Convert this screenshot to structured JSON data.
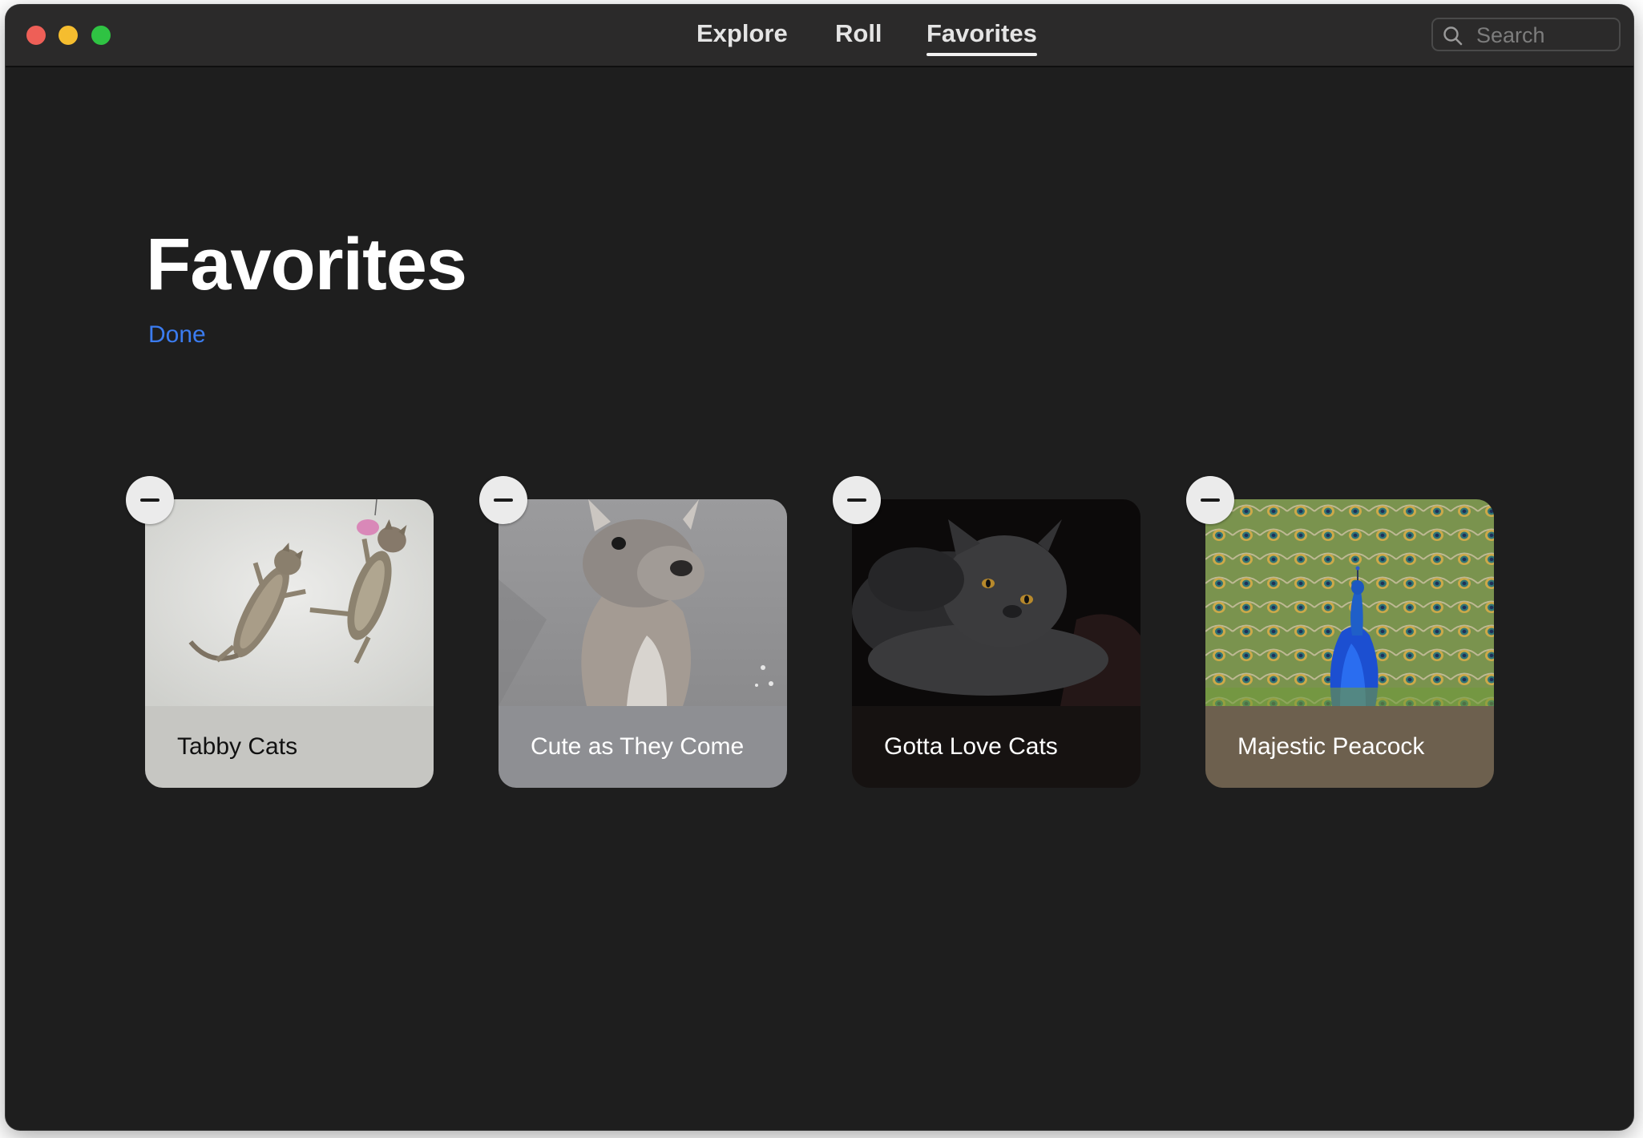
{
  "tabs": [
    {
      "label": "Explore"
    },
    {
      "label": "Roll"
    },
    {
      "label": "Favorites",
      "active": true
    }
  ],
  "search": {
    "placeholder": "Search"
  },
  "page": {
    "title": "Favorites",
    "done_label": "Done"
  },
  "cards": [
    {
      "label": "Tabby Cats",
      "label_bg": "#c6c6c2",
      "label_color": "#111111",
      "image": "two-tabby-cats-jumping"
    },
    {
      "label": "Cute as They Come",
      "label_bg": "#8e8f93",
      "label_color": "#ffffff",
      "image": "kangaroo-closeup"
    },
    {
      "label": "Gotta Love Cats",
      "label_bg": "#161211",
      "label_color": "#ffffff",
      "image": "black-persian-cat"
    },
    {
      "label": "Majestic Peacock",
      "label_bg": "#6d604e",
      "label_color": "#ffffff",
      "image": "peacock-fanned-tail"
    }
  ],
  "colors": {
    "accent": "#3b7cf0",
    "window_bg": "#1e1e1e"
  },
  "icons": [
    "search-icon",
    "minus-icon"
  ]
}
